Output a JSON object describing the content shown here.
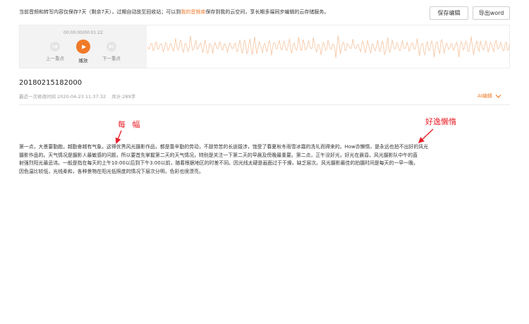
{
  "notice": {
    "before": "当前音频和转写内容仅保存7天（剩余7天），过期自动放至回收站；可以到",
    "link": "我的音频库",
    "after": "保存到我的云空间，享长期多端同步编辑的云存储服务。"
  },
  "toolbar": {
    "save_label": "保存编辑",
    "export_label": "导出word"
  },
  "player": {
    "time": "00:00:00/00:01:22",
    "prev_label": "上一重点",
    "play_label": "播放",
    "next_label": "下一重点",
    "icons": {
      "prev": "skip-prev-icon",
      "play": "play-icon",
      "next": "skip-next-icon"
    },
    "accent": "#f07a28"
  },
  "doc": {
    "title": "20180215182000",
    "last_modified": "最近一次修改时间 2020-04-23 11:37:32",
    "word_count": "共计:289字",
    "ai_edit": "AI编辑"
  },
  "annotations": {
    "left": "每 幅",
    "right": "好逸懒惰",
    "color": "#e8202a"
  },
  "body_lines": [
    "第一点，大景要勤跑，越勤奋越有气象。这得优秀风光摄影作品，都是靠辛勤的劳动，不辞劳苦的长途跋涉，饱受了春夏秋冬雨雪冰霜的洗礼而得来的。How亦懒惰，是永远也拍不出好的风光",
    "摄影作品的。天气情况是摄影人最敏感的问题，所以要首先掌握第二天的天气情况，特别是关注一下第二天的早晨及傍晚最重要。第二点，正午没好光，好光在晨昏。风光摄影队中午的直",
    "射强烈阳光最忌讳。一般是指在每天的上午10:00以后到下午3:00以前，随着根据地区的时差不同。因光线太硬是画面过于干燥，缺乏层次。风光摄影最佳的拍摄时间是每天的一早一晚，",
    "因色温比较低，光线柔和，各种景物在阳光低照度的情况下层次分明，色彩也很漂亮。"
  ]
}
